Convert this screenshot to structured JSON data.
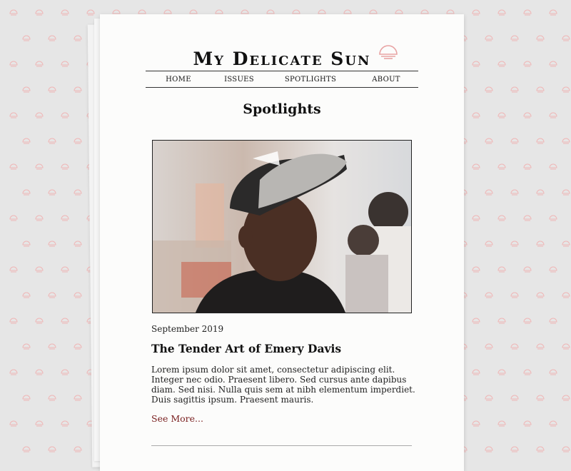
{
  "site": {
    "title": "My Delicate Sun",
    "logo_icon": "sun-bell-icon"
  },
  "nav": {
    "items": [
      {
        "label": "HOME"
      },
      {
        "label": "ISSUES"
      },
      {
        "label": "SPOTLIGHTS"
      },
      {
        "label": "ABOUT"
      }
    ]
  },
  "page": {
    "section_title": "Spotlights"
  },
  "article": {
    "date": "September 2019",
    "title": "The Tender Art of Emery Davis",
    "excerpt": "Lorem ipsum dolor sit amet, consectetur adipiscing elit. Integer nec odio. Praesent libero. Sed cursus ante dapibus diam. Sed nisi. Nulla quis sem at nibh elementum imperdiet. Duis sagittis ipsum. Praesent mauris.",
    "link_label": "See More..."
  },
  "colors": {
    "background": "#e6e6e6",
    "pattern": "#efb6b6",
    "link": "#7a2020",
    "paper": "#fcfcfb"
  }
}
